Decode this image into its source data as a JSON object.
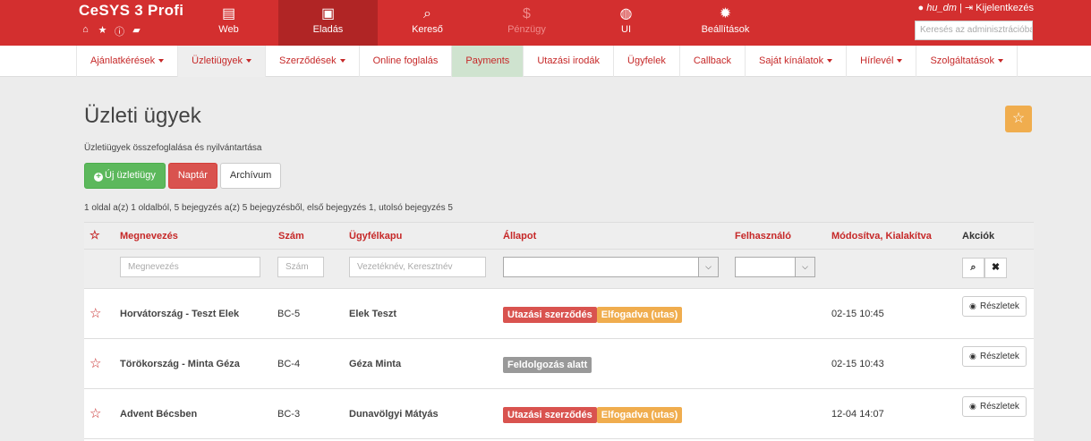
{
  "app": {
    "brand": "CeSYS 3 Profi",
    "user": "hu_dm",
    "logout_label": "Kijelentkezés",
    "search_placeholder": "Keresés az adminisztrációban"
  },
  "topnav": [
    {
      "label": "Web",
      "icon": "document-icon"
    },
    {
      "label": "Eladás",
      "icon": "briefcase-icon"
    },
    {
      "label": "Kereső",
      "icon": "search-icon"
    },
    {
      "label": "Pénzügy",
      "icon": "dollar-icon"
    },
    {
      "label": "UI",
      "icon": "globe-icon"
    },
    {
      "label": "Beállítások",
      "icon": "gear-icon"
    }
  ],
  "subnav": [
    {
      "label": "Ajánlatkérések"
    },
    {
      "label": "Üzletiügyek"
    },
    {
      "label": "Szerződések"
    },
    {
      "label": "Online foglalás"
    },
    {
      "label": "Payments"
    },
    {
      "label": "Utazási irodák"
    },
    {
      "label": "Ügyfelek"
    },
    {
      "label": "Callback"
    },
    {
      "label": "Saját kínálatok"
    },
    {
      "label": "Hírlevél"
    },
    {
      "label": "Szolgáltatások"
    }
  ],
  "page": {
    "title": "Üzleti ügyek",
    "subtitle": "Üzletiügyek összefoglalása és nyilvántartása",
    "buttons": {
      "new": "Új üzletiügy",
      "calendar": "Naptár",
      "archive": "Archívum"
    },
    "pagination_info": "1 oldal a(z) 1 oldalból, 5 bejegyzés a(z) 5 bejegyzésből, első bejegyzés 1, utolsó bejegyzés 5"
  },
  "table": {
    "columns": {
      "name": "Megnevezés",
      "number": "Szám",
      "client": "Ügyfélkapu",
      "status": "Állapot",
      "user": "Felhasználó",
      "modified": "Módosítva, Kialakítva",
      "actions": "Akciók"
    },
    "filters": {
      "name_placeholder": "Megnevezés",
      "number_placeholder": "Szám",
      "client_placeholder": "Vezetéknév, Keresztnév"
    },
    "details_label": "Részletek",
    "rows": [
      {
        "name": "Horvátország - Teszt Elek",
        "number": "BC-5",
        "client": "Elek Teszt",
        "badge1": "Utazási szerződés",
        "badge2": "Elfogadva (utas)",
        "modified": "02-15 10:45"
      },
      {
        "name": "Törökország - Minta Géza",
        "number": "BC-4",
        "client": "Géza Minta",
        "badge1": "Feldolgozás alatt",
        "modified": "02-15 10:43"
      },
      {
        "name": "Advent Bécsben",
        "number": "BC-3",
        "client": "Dunavölgyi Mátyás",
        "badge1": "Utazási szerződés",
        "badge2": "Elfogadva (utas)",
        "modified": "12-04 14:07"
      }
    ]
  }
}
